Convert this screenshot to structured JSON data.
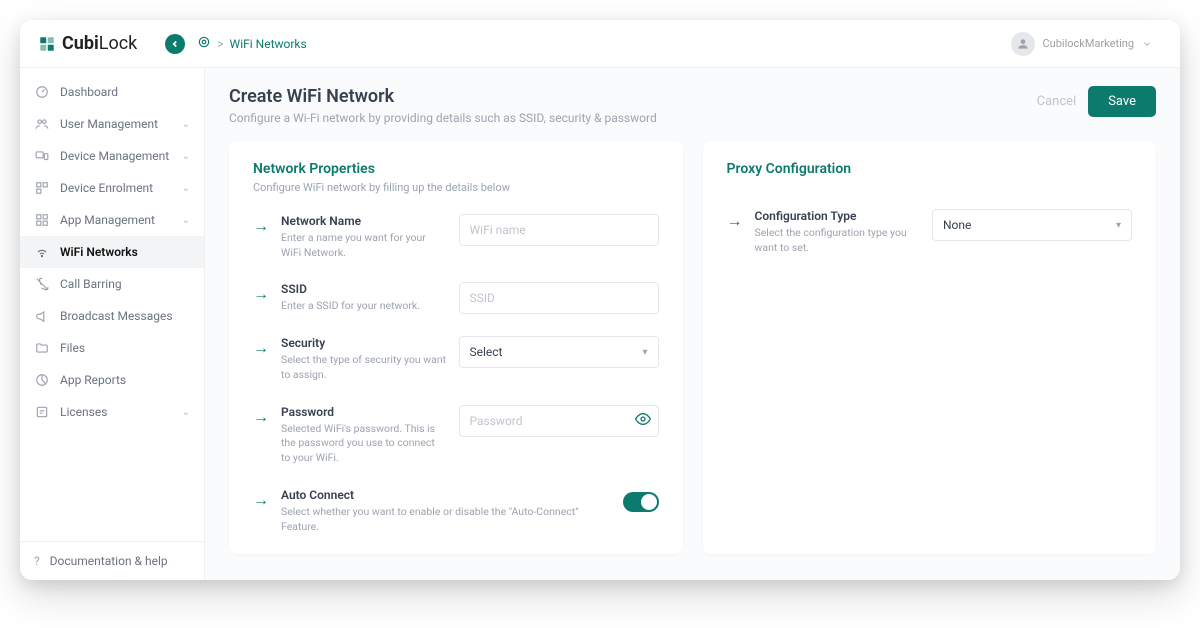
{
  "brand": {
    "name_a": "Cubi",
    "name_b": "Lock"
  },
  "breadcrumb": {
    "label": "WiFi Networks",
    "sep": ">"
  },
  "user": {
    "name": "CubilockMarketing"
  },
  "sidebar": {
    "items": [
      {
        "label": "Dashboard"
      },
      {
        "label": "User Management",
        "expandable": true
      },
      {
        "label": "Device Management",
        "expandable": true
      },
      {
        "label": "Device Enrolment",
        "expandable": true
      },
      {
        "label": "App Management",
        "expandable": true
      },
      {
        "label": "WiFi Networks"
      },
      {
        "label": "Call Barring"
      },
      {
        "label": "Broadcast Messages"
      },
      {
        "label": "Files"
      },
      {
        "label": "App Reports"
      },
      {
        "label": "Licenses",
        "expandable": true
      }
    ],
    "help": "Documentation & help"
  },
  "page": {
    "title": "Create WiFi Network",
    "subtitle": "Configure a Wi-Fi network by providing details such as SSID, security & password",
    "cancel": "Cancel",
    "save": "Save"
  },
  "network": {
    "title": "Network Properties",
    "subtitle": "Configure WiFi network by filling up the details below",
    "fields": {
      "name": {
        "label": "Network Name",
        "desc": "Enter a name you want for your WiFi Network.",
        "placeholder": "WiFi name"
      },
      "ssid": {
        "label": "SSID",
        "desc": "Enter a SSID for your network.",
        "placeholder": "SSID"
      },
      "security": {
        "label": "Security",
        "desc": "Select the type of security you want to assign.",
        "value": "Select"
      },
      "password": {
        "label": "Password",
        "desc": "Selected WiFi's password. This is the password you use to connect to your WiFi.",
        "placeholder": "Password"
      },
      "auto": {
        "label": "Auto Connect",
        "desc": "Select whether you want to enable or disable the \"Auto-Connect\" Feature."
      }
    }
  },
  "proxy": {
    "title": "Proxy Configuration",
    "field": {
      "label": "Configuration Type",
      "desc": "Select the configuration type you want to set.",
      "value": "None"
    }
  }
}
